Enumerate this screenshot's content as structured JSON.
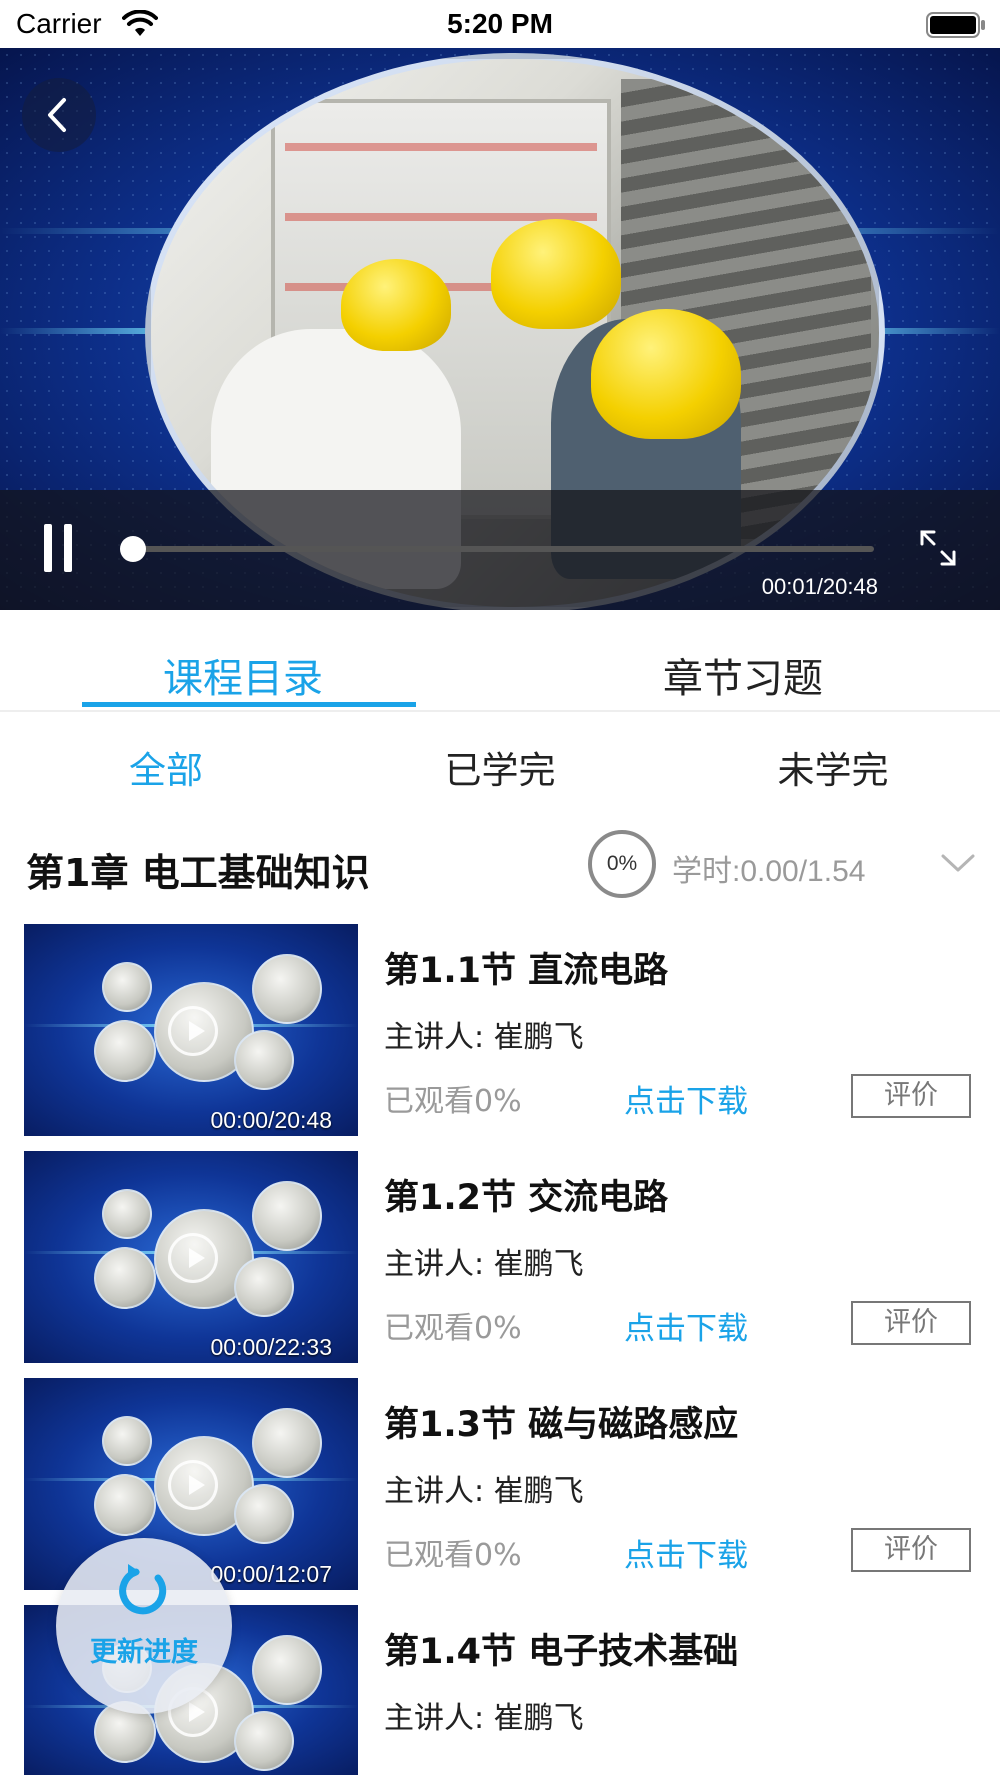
{
  "status_bar": {
    "carrier": "Carrier",
    "time": "5:20 PM"
  },
  "player": {
    "elapsed_time": "00:01/20:48",
    "progress_fraction": 0.0008,
    "icons": [
      "back-icon",
      "pause-icon",
      "fullscreen-icon"
    ]
  },
  "tabs": [
    {
      "label": "课程目录",
      "active": true
    },
    {
      "label": "章节习题",
      "active": false
    }
  ],
  "filters": [
    {
      "label": "全部",
      "active": true
    },
    {
      "label": "已学完",
      "active": false
    },
    {
      "label": "未学完",
      "active": false
    }
  ],
  "chapter": {
    "title": "第1章  电工基础知识",
    "progress": "0%",
    "study_hours": "学时:0.00/1.54"
  },
  "lessons": [
    {
      "title": "第1.1节 直流电路",
      "lecturer": "主讲人:  崔鹏飞",
      "watched": "已观看0%",
      "download": "点击下载",
      "rate": "评价",
      "duration": "00:00/20:48"
    },
    {
      "title": "第1.2节 交流电路",
      "lecturer": "主讲人:  崔鹏飞",
      "watched": "已观看0%",
      "download": "点击下载",
      "rate": "评价",
      "duration": "00:00/22:33"
    },
    {
      "title": "第1.3节 磁与磁路感应",
      "lecturer": "主讲人:  崔鹏飞",
      "watched": "已观看0%",
      "download": "点击下载",
      "rate": "评价",
      "duration": "00:00/12:07"
    },
    {
      "title": "第1.4节 电子技术基础",
      "lecturer": "主讲人:  崔鹏飞",
      "watched": "",
      "download": "",
      "rate": "",
      "duration": ""
    }
  ],
  "refresh_button": {
    "label": "更新进度"
  },
  "colors": {
    "accent": "#1aa3e8",
    "muted": "#9a9a9a"
  }
}
